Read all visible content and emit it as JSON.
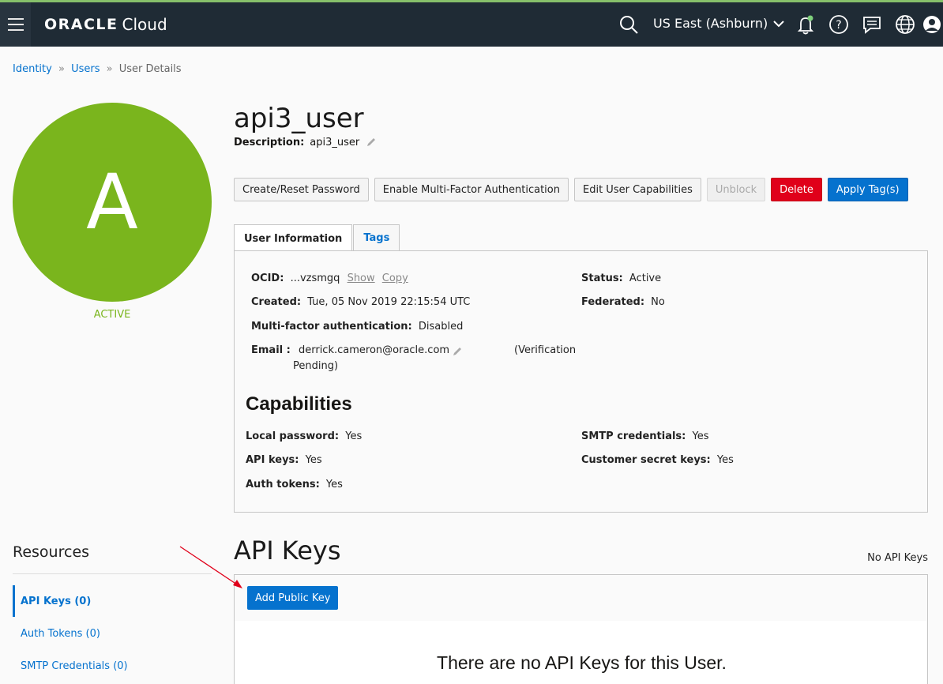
{
  "header": {
    "brand_main": "ORACLE",
    "brand_sub": "Cloud",
    "region": "US East (Ashburn)"
  },
  "breadcrumb": {
    "identity": "Identity",
    "users": "Users",
    "sep": "»",
    "current": "User Details"
  },
  "user": {
    "initial": "A",
    "status": "ACTIVE",
    "name": "api3_user",
    "description_label": "Description:",
    "description": "api3_user"
  },
  "actions": {
    "reset_password": "Create/Reset Password",
    "mfa": "Enable Multi-Factor Authentication",
    "edit_capabilities": "Edit User Capabilities",
    "unblock": "Unblock",
    "delete": "Delete",
    "apply_tags": "Apply Tag(s)"
  },
  "tabs": {
    "user_info": "User Information",
    "tags": "Tags"
  },
  "info": {
    "ocid_label": "OCID:",
    "ocid": "...vzsmgq",
    "show": "Show",
    "copy": "Copy",
    "status_label": "Status:",
    "status": "Active",
    "created_label": "Created:",
    "created": "Tue, 05 Nov 2019 22:15:54 UTC",
    "federated_label": "Federated:",
    "federated": "No",
    "mfa_label": "Multi-factor authentication:",
    "mfa": "Disabled",
    "email_label": "Email :",
    "email": "derrick.cameron@oracle.com",
    "verification_1": "(Verification",
    "verification_2": "Pending)"
  },
  "capabilities": {
    "heading": "Capabilities",
    "local_password_label": "Local password:",
    "local_password": "Yes",
    "smtp_label": "SMTP credentials:",
    "smtp": "Yes",
    "api_keys_label": "API keys:",
    "api_keys": "Yes",
    "customer_secret_label": "Customer secret keys:",
    "customer_secret": "Yes",
    "auth_tokens_label": "Auth tokens:",
    "auth_tokens": "Yes"
  },
  "resources": {
    "title": "Resources",
    "items": [
      "API Keys (0)",
      "Auth Tokens (0)",
      "SMTP Credentials (0)"
    ]
  },
  "api_keys": {
    "heading": "API Keys",
    "count_text": "No API Keys",
    "add_button": "Add Public Key",
    "empty_message": "There are no API Keys for this User."
  },
  "colors": {
    "header_bg": "#1f2b35",
    "accent_blue": "#0572ce",
    "avatar_green": "#7ab51d",
    "delete_red": "#e0001a"
  }
}
